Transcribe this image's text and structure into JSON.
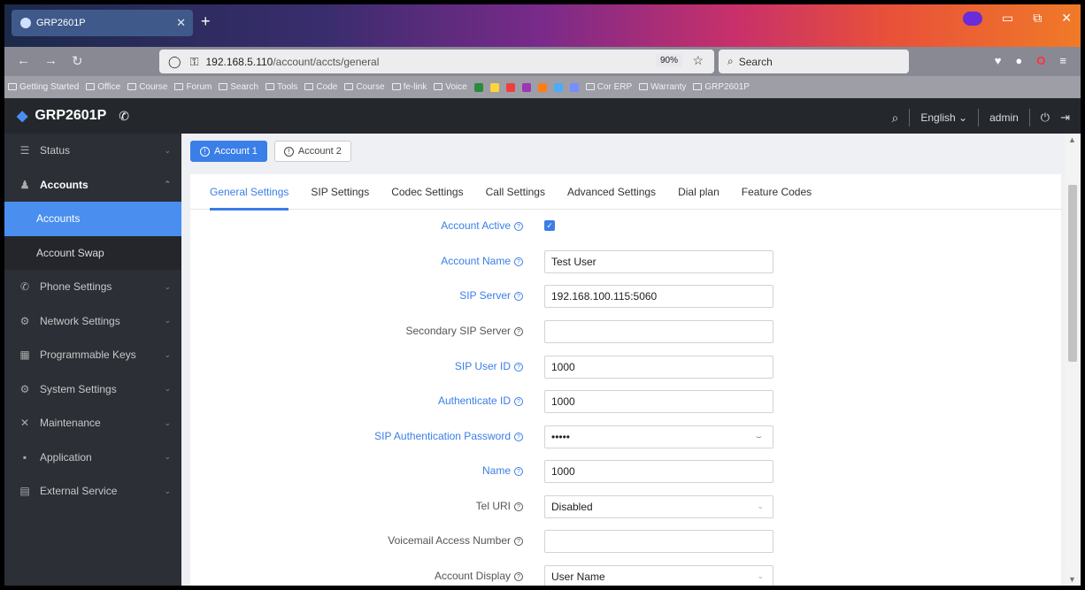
{
  "browser": {
    "tab_title": "GRP2601P",
    "url_host": "192.168.5.110",
    "url_path": "/account/accts/general",
    "zoom": "90%",
    "search_placeholder": "Search",
    "bookmarks": [
      "Getting Started",
      "Office",
      "Course",
      "Forum",
      "Search",
      "Tools",
      "Code",
      "Course",
      "fe-link",
      "Voice",
      "Cor ERP",
      "Warranty",
      "GRP2601P"
    ]
  },
  "app": {
    "title": "GRP2601P",
    "language": "English",
    "user": "admin"
  },
  "sidebar": {
    "items": [
      {
        "label": "Status",
        "icon": "list-icon",
        "expanded": false
      },
      {
        "label": "Accounts",
        "icon": "person-icon",
        "expanded": true
      },
      {
        "label": "Accounts",
        "sub": true,
        "active": true
      },
      {
        "label": "Account Swap",
        "sub": true
      },
      {
        "label": "Phone Settings",
        "icon": "phone-icon"
      },
      {
        "label": "Network Settings",
        "icon": "network-icon"
      },
      {
        "label": "Programmable Keys",
        "icon": "keypad-icon"
      },
      {
        "label": "System Settings",
        "icon": "system-icon"
      },
      {
        "label": "Maintenance",
        "icon": "tools-icon"
      },
      {
        "label": "Application",
        "icon": "grid-icon"
      },
      {
        "label": "External Service",
        "icon": "document-icon"
      }
    ]
  },
  "account_tabs": [
    "Account 1",
    "Account 2"
  ],
  "settings_tabs": [
    "General Settings",
    "SIP Settings",
    "Codec Settings",
    "Call Settings",
    "Advanced Settings",
    "Dial plan",
    "Feature Codes"
  ],
  "form": {
    "account_active": {
      "label": "Account Active",
      "checked": true
    },
    "account_name": {
      "label": "Account Name",
      "value": "Test User"
    },
    "sip_server": {
      "label": "SIP Server",
      "value": "192.168.100.115:5060"
    },
    "secondary_sip_server": {
      "label": "Secondary SIP Server",
      "value": ""
    },
    "sip_user_id": {
      "label": "SIP User ID",
      "value": "1000"
    },
    "authenticate_id": {
      "label": "Authenticate ID",
      "value": "1000"
    },
    "sip_auth_password": {
      "label": "SIP Authentication Password",
      "value": "•••••"
    },
    "name": {
      "label": "Name",
      "value": "1000"
    },
    "tel_uri": {
      "label": "Tel URI",
      "value": "Disabled"
    },
    "voicemail_access_number": {
      "label": "Voicemail Access Number",
      "value": ""
    },
    "account_display": {
      "label": "Account Display",
      "value": "User Name"
    }
  },
  "colors": {
    "accent": "#3a7ee8",
    "sidebar": "#2c2f36",
    "header": "#24272c"
  }
}
